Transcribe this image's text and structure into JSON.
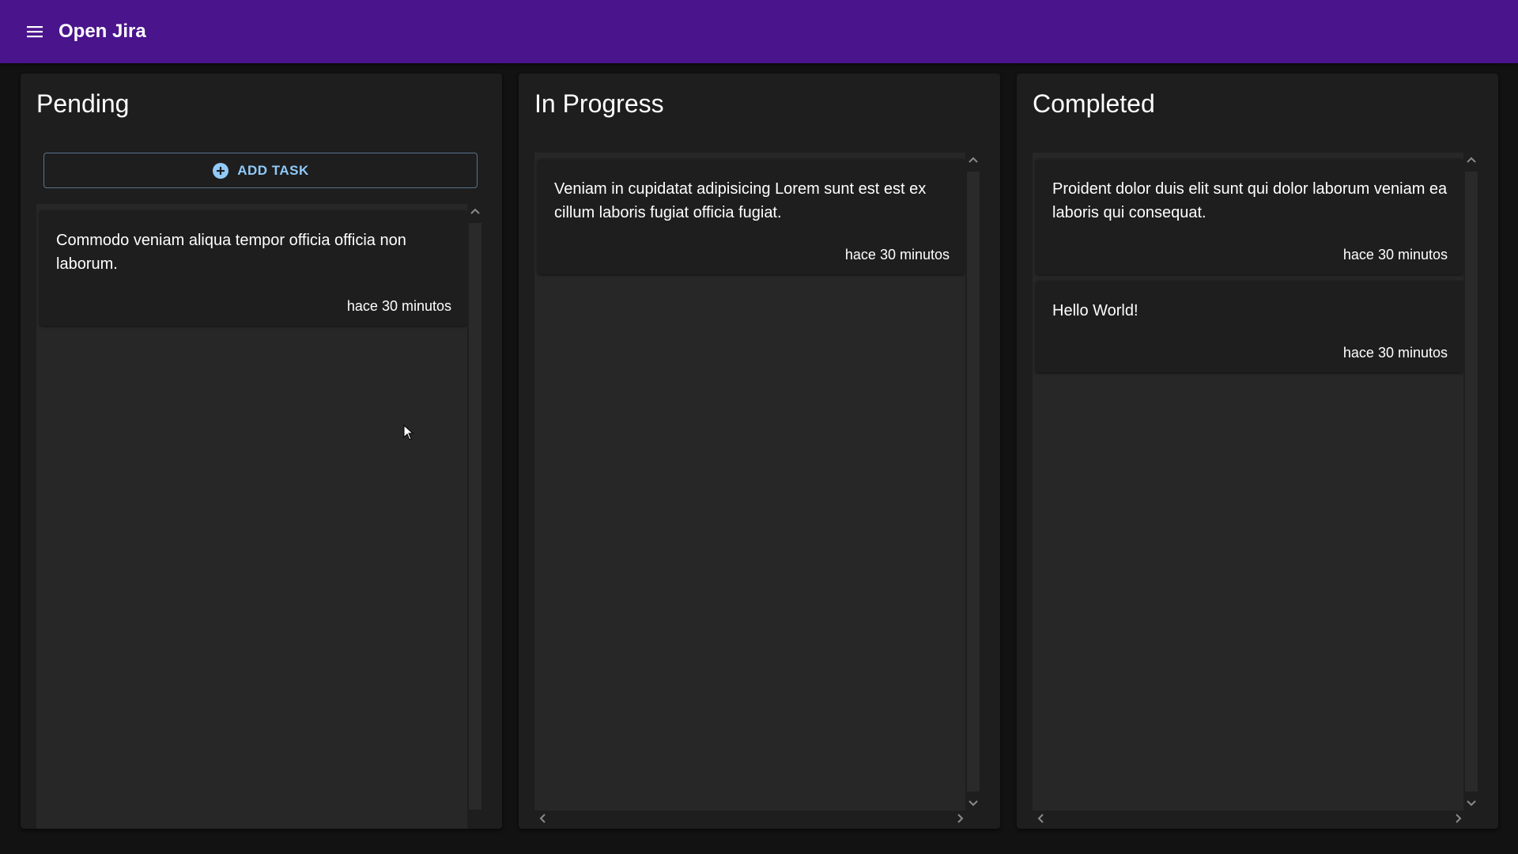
{
  "app": {
    "title": "Open Jira",
    "header_color": "#4a148c",
    "menu_icon": "hamburger-menu-icon"
  },
  "add_task": {
    "label": "ADD TASK",
    "icon": "add-circle-icon",
    "color": "#90caf9"
  },
  "columns": [
    {
      "title": "Pending",
      "cards": [
        {
          "text": "Commodo veniam aliqua tempor officia officia non laborum.",
          "time": "hace 30 minutos"
        }
      ]
    },
    {
      "title": "In Progress",
      "cards": [
        {
          "text": "Veniam in cupidatat adipisicing Lorem sunt est est ex cillum laboris fugiat officia fugiat.",
          "time": "hace 30 minutos"
        }
      ]
    },
    {
      "title": "Completed",
      "cards": [
        {
          "text": "Proident dolor duis elit sunt qui dolor laborum veniam ea laboris qui consequat.",
          "time": "hace 30 minutos"
        },
        {
          "text": "Hello World!",
          "time": "hace 30 minutos"
        }
      ]
    }
  ]
}
